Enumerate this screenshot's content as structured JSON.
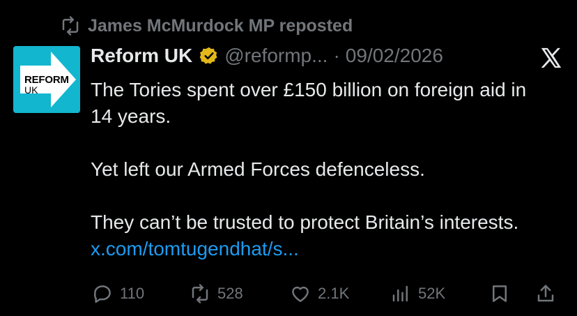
{
  "repost": {
    "label": "James McMurdock MP reposted"
  },
  "avatar": {
    "line1": "REFORM",
    "line2": "UK"
  },
  "tweet": {
    "name": "Reform UK",
    "handle": "@reformp...",
    "separator": "·",
    "date": "09/02/2026",
    "paragraphs": [
      "The Tories spent over £150 billion on foreign aid in 14 years.",
      "Yet left our Armed Forces defenceless.",
      "They can’t be trusted to protect Britain’s interests."
    ],
    "link": "x.com/tomtugendhat/s..."
  },
  "actions": {
    "replies": "110",
    "reposts": "528",
    "likes": "2.1K",
    "views": "52K"
  },
  "colors": {
    "background": "#000000",
    "text": "#e7e9ea",
    "muted": "#71767b",
    "link": "#1d9bf0",
    "verified": "#e2b719",
    "avatar_bg": "#12b6cf"
  }
}
